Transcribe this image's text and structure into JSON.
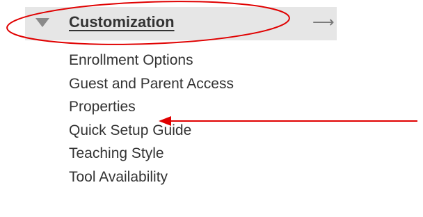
{
  "section": {
    "title": "Customization",
    "expanded_icon": "triangle-down-icon",
    "arrow_icon": "arrow-right-icon",
    "arrow_glyph": "⟶"
  },
  "menu": {
    "items": [
      {
        "label": "Enrollment Options"
      },
      {
        "label": "Guest and Parent Access"
      },
      {
        "label": "Properties"
      },
      {
        "label": "Quick Setup Guide"
      },
      {
        "label": "Teaching Style"
      },
      {
        "label": "Tool Availability"
      }
    ]
  },
  "colors": {
    "header_background": "#e6e6e6",
    "text": "#333333",
    "annotation_red": "#e00000"
  }
}
